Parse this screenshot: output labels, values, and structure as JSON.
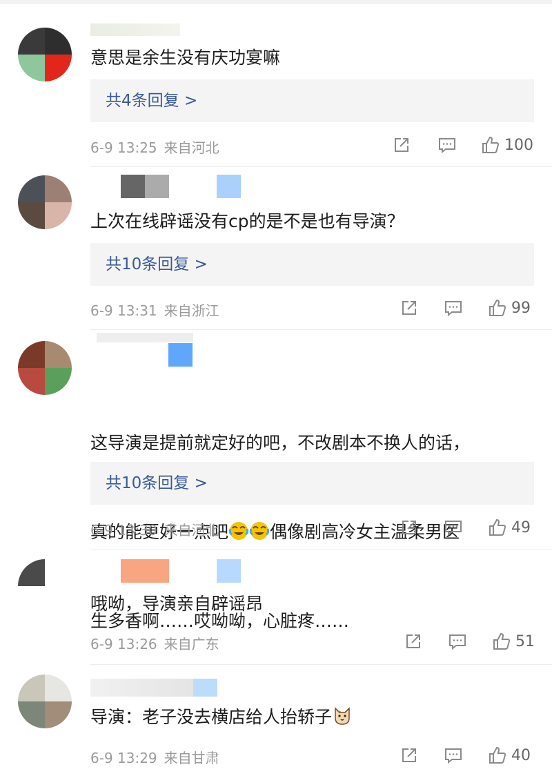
{
  "comments": [
    {
      "text": "意思是余生没有庆功宴嘛",
      "replies": "共4条回复 >",
      "date": "6-9 13:25",
      "location": "来自河北",
      "likes": "100",
      "avatar_colors": [
        "#3a3a3a",
        "#2e2e2e",
        "#8fc79d",
        "#e3261b"
      ]
    },
    {
      "text": "上次在线辟谣没有cp的是不是也有导演？",
      "replies": "共10条回复 >",
      "date": "6-9 13:31",
      "location": "来自浙江",
      "likes": "99",
      "avatar_colors": [
        "#4b5157",
        "#9e7f74",
        "#5b4a3f",
        "#d9b4a9"
      ]
    },
    {
      "text_line1": "这导演是提前就定好的吧，不改剧本不换人的话，",
      "text_line2a": "真的能更好一点吧",
      "text_line2b": "偶像剧高冷女主温柔男医",
      "text_line3": "生多香啊……哎呦呦，心脏疼……",
      "replies": "共10条回复 >",
      "date": "6-9 13:30",
      "location": "来自河北",
      "likes": "49",
      "avatar_colors": [
        "#7a3a2a",
        "#a88a70",
        "#b84a40",
        "#5aa05a"
      ]
    },
    {
      "text": "哦呦，导演亲自辟谣昂",
      "date": "6-9 13:26",
      "location": "来自广东",
      "likes": "51",
      "avatar_colors": [
        "#4a4a4a",
        "#ffffff",
        "#ffffff",
        "#ffffff"
      ]
    },
    {
      "text": "导演：老子没去横店给人抬轿子",
      "date": "6-9 13:29",
      "location": "来自甘肃",
      "likes": "40",
      "avatar_colors": [
        "#c8c7b8",
        "#e6e6e2",
        "#7d8779",
        "#a28c7a"
      ]
    }
  ],
  "icons": {
    "share": "share-icon",
    "comment": "comment-icon",
    "like": "like-icon",
    "emoji_cry": "crying-laugh-emoji",
    "emoji_cat": "cat-emoji"
  },
  "colors": {
    "link": "#3a5a95",
    "meta": "#9a9a9a",
    "reply_bg": "#f4f4f4"
  }
}
